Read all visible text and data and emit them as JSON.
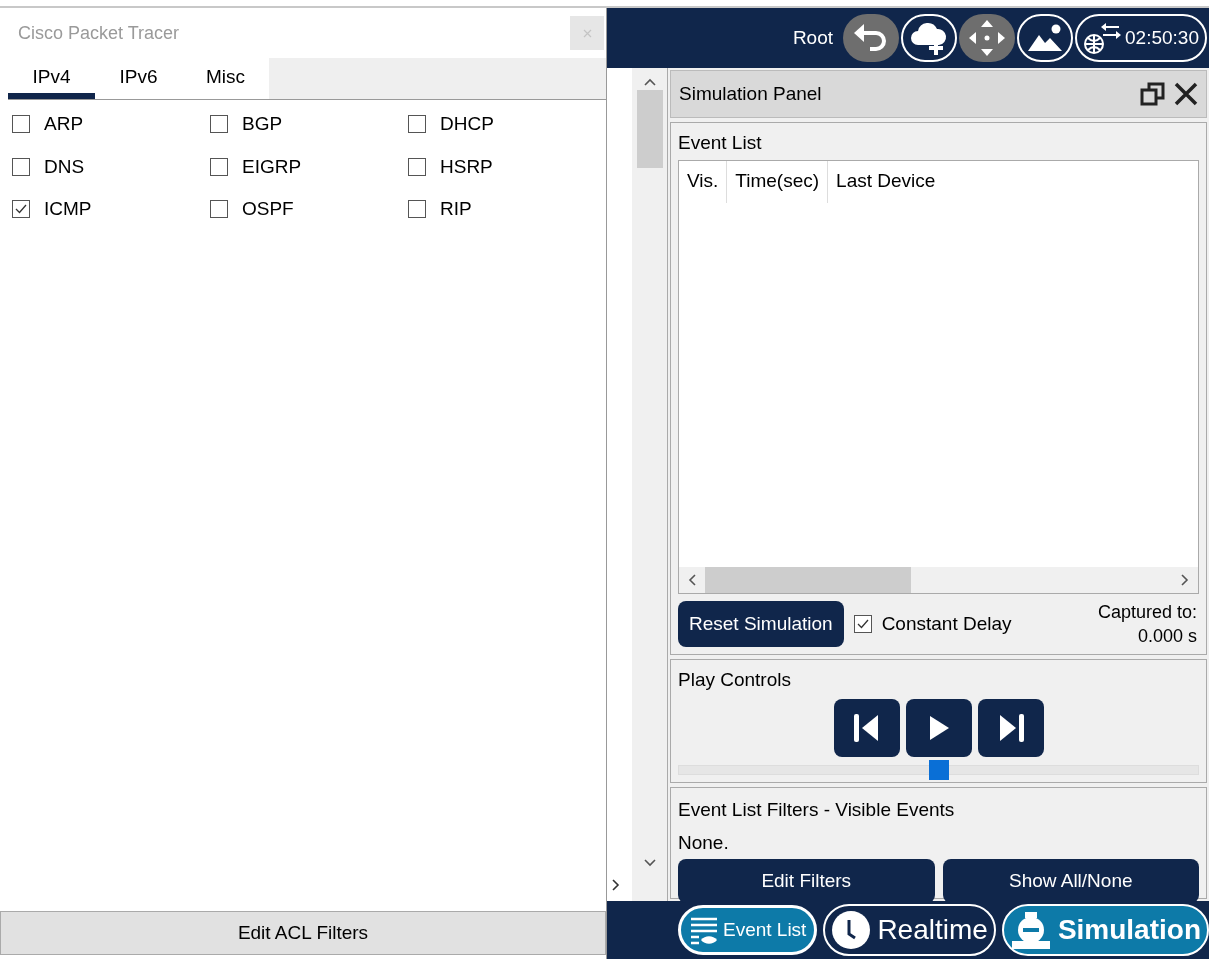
{
  "dialog": {
    "title": "Cisco Packet Tracer",
    "tabs": [
      {
        "label": "IPv4",
        "selected": true
      },
      {
        "label": "IPv6",
        "selected": false
      },
      {
        "label": "Misc",
        "selected": false
      }
    ],
    "filters": [
      {
        "label": "ARP",
        "checked": false
      },
      {
        "label": "BGP",
        "checked": false
      },
      {
        "label": "DHCP",
        "checked": false
      },
      {
        "label": "DNS",
        "checked": false
      },
      {
        "label": "EIGRP",
        "checked": false
      },
      {
        "label": "HSRP",
        "checked": false
      },
      {
        "label": "ICMP",
        "checked": true
      },
      {
        "label": "OSPF",
        "checked": false
      },
      {
        "label": "RIP",
        "checked": false
      }
    ],
    "edit_acl_button": "Edit ACL Filters"
  },
  "toolbar": {
    "label": "Root",
    "time": "02:50:30"
  },
  "simulation_panel": {
    "title": "Simulation Panel",
    "event_list": {
      "title": "Event List",
      "columns": [
        "Vis.",
        "Time(sec)",
        "Last Device"
      ]
    },
    "reset_button": "Reset Simulation",
    "constant_delay": {
      "label": "Constant Delay",
      "checked": true
    },
    "captured_label": "Captured to:",
    "captured_value": "0.000 s",
    "play_controls": {
      "title": "Play Controls",
      "level": 0.5
    },
    "filters": {
      "title": "Event List Filters - Visible Events",
      "value": "None.",
      "buttons": [
        "Edit Filters",
        "Show All/None"
      ]
    }
  },
  "bottom_bar": {
    "event_list": {
      "label": "Event List",
      "on": true
    },
    "modes": [
      {
        "label": "Realtime",
        "selected": false
      },
      {
        "label": "Simulation",
        "selected": true
      }
    ]
  }
}
